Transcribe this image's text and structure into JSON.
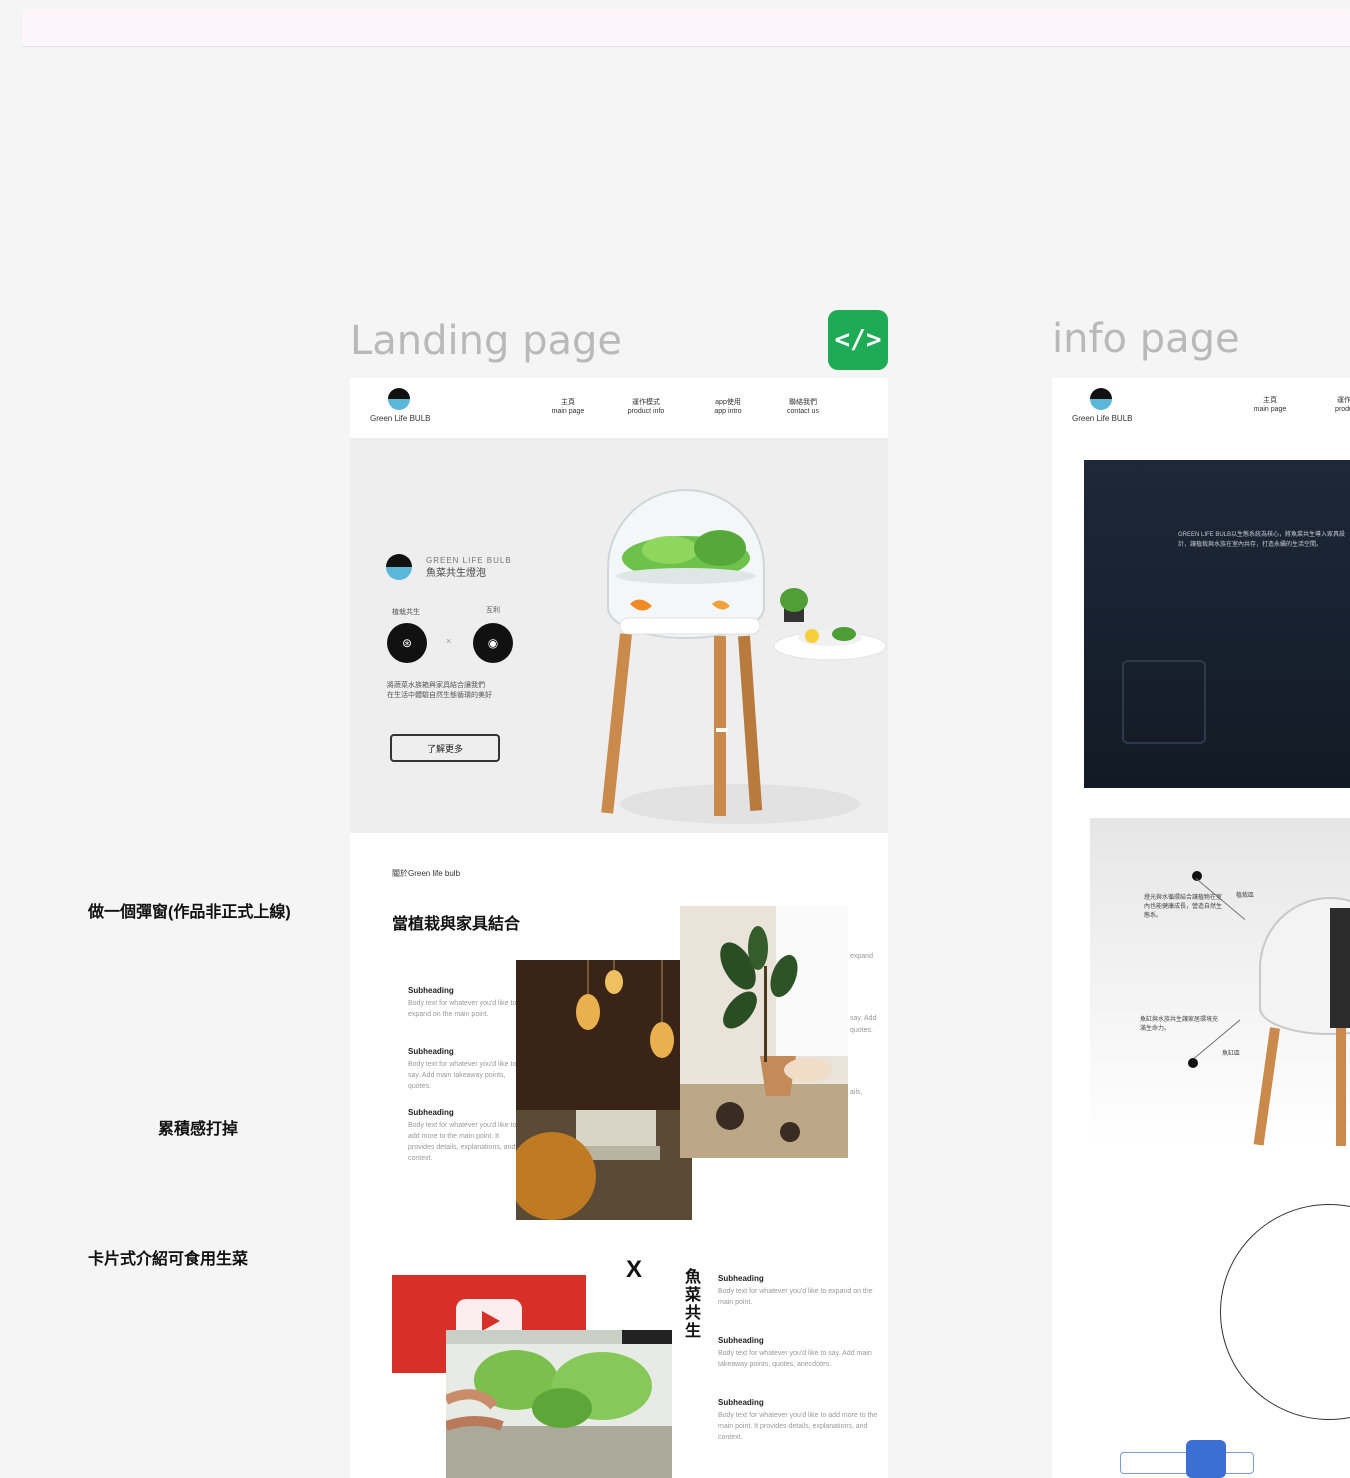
{
  "frames": {
    "landing_title": "Landing page",
    "info_title": "info page",
    "code_icon": "code-icon"
  },
  "notes": {
    "popup": "做一個彈窗(作品非正式上線)",
    "remove_heavy": "累積感打掉",
    "cards": "卡片式介紹可食用生菜"
  },
  "landing": {
    "brand": "Green Life BULB",
    "nav": [
      {
        "zh": "主頁",
        "en": "main page"
      },
      {
        "zh": "運作模式",
        "en": "product info"
      },
      {
        "zh": "app使用",
        "en": "app intro"
      },
      {
        "zh": "聯絡我們",
        "en": "contact us"
      }
    ],
    "hero": {
      "brand_en": "GREEN LIFE BULB",
      "brand_zh": "魚菜共生燈泡",
      "label_left": "植栽共生",
      "label_right": "互利",
      "times": "×",
      "desc_line1": "將蔬菜水族箱與家具結合讓我們",
      "desc_line2": "在生活中體驗自然生態循環的美好",
      "button": "了解更多"
    },
    "section2": {
      "kicker": "關於Green life bulb",
      "heading": "當植栽與家具結合",
      "subheading": "Subheading",
      "item1_body": "Body text for whatever you'd like to expand on the main point.",
      "item2_body": "Body text for whatever you'd like to say. Add main takeaway points, quotes.",
      "item3_body": "Body text for whatever you'd like to add more to the main point. It provides details, explanations, and context.",
      "right_frag1": "expand",
      "right_frag2": "say. Add",
      "right_frag3": "quotes.",
      "right_frag4": "ails,"
    },
    "section3": {
      "x_mark": "X",
      "vertical": "魚菜共生",
      "subheading": "Subheading",
      "item1_body": "Body text for whatever you'd like to expand on the main point.",
      "item2_body": "Body text for whatever you'd like to say. Add main takeaway points, quotes, anecdotes.",
      "item3_body": "Body text for whatever you'd like to add more to the main point. It provides details, explanations, and context."
    }
  },
  "info": {
    "brand": "Green Life BULB",
    "nav": [
      {
        "zh": "主頁",
        "en": "main page"
      },
      {
        "zh": "運作",
        "en": "produ"
      }
    ],
    "dark_text": "GREEN LIFE BULB以生態系統為核心，將魚菜共生導入家具設計，讓植栽與水族在室內共存，打造永續的生活空間。",
    "annot_top": "燈光與水循環結合讓植物在室內也能健康成長，營造自然生態系。",
    "annot_top_label": "植栽區",
    "annot_bottom": "魚缸與水族共生讓家居環境充滿生命力。",
    "annot_bottom_label": "魚缸區"
  }
}
